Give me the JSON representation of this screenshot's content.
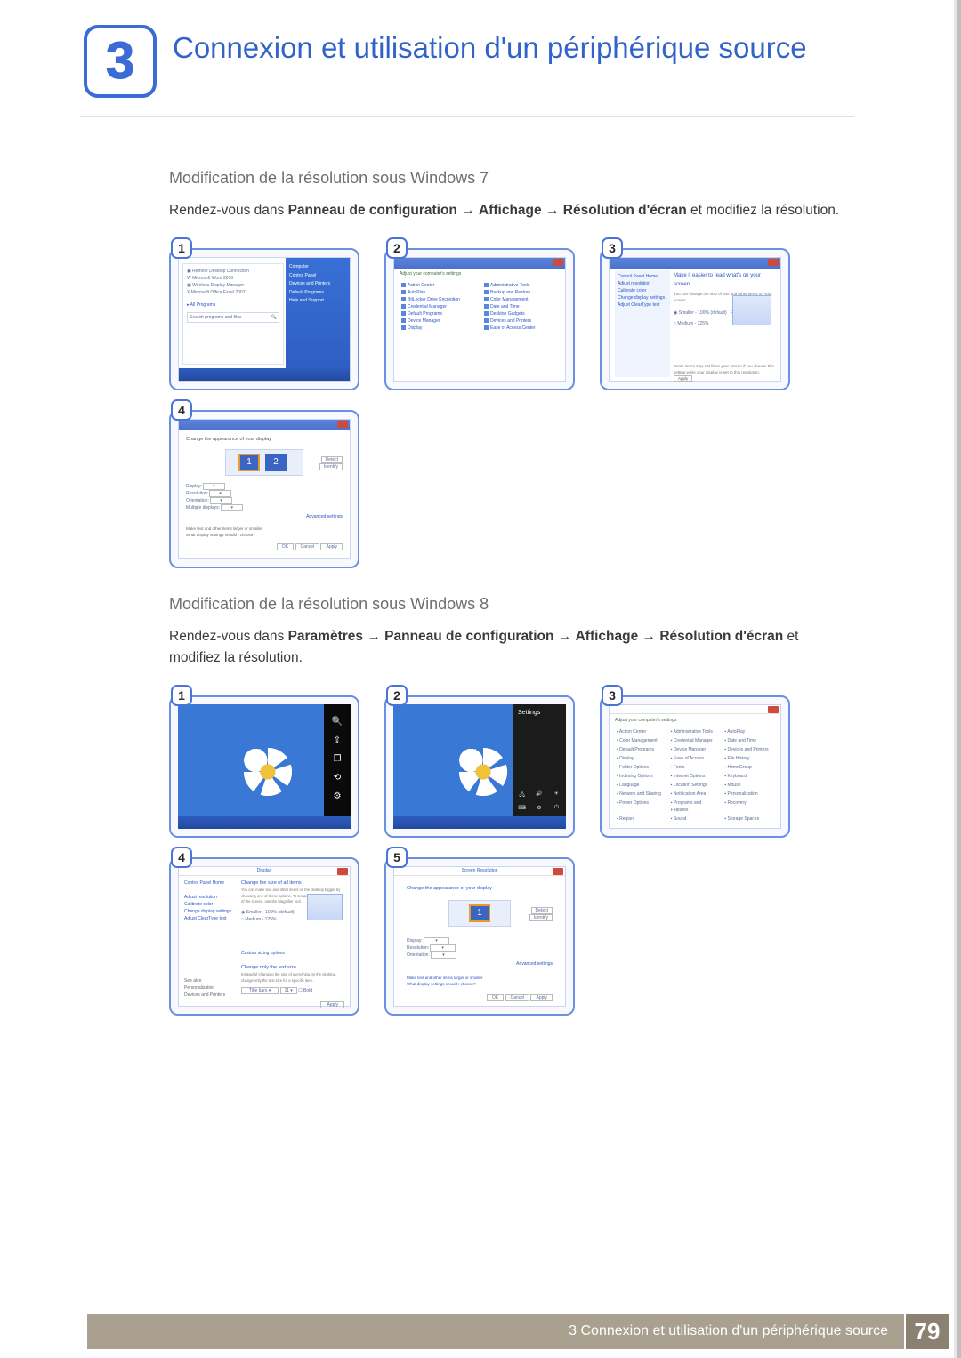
{
  "chapter": {
    "number": "3",
    "title": "Connexion et utilisation d'un périphérique source"
  },
  "win7": {
    "heading": "Modification de la résolution sous Windows 7",
    "instr_pre": "Rendez-vous dans ",
    "path_1": "Panneau de configuration",
    "arrow": " → ",
    "path_2": "Affichage",
    "path_3": "Résolution d'écran",
    "instr_post": " et modifiez la résolution.",
    "steps": {
      "s1": "1",
      "s2": "2",
      "s3": "3",
      "s4": "4"
    }
  },
  "win8": {
    "heading": "Modification de la résolution sous Windows 8",
    "instr_pre": "Rendez-vous dans ",
    "path_0": "Paramètres",
    "arrow": " → ",
    "path_1": "Panneau de configuration",
    "path_2": "Affichage",
    "path_3": "Résolution d'écran",
    "instr_post": " et modifiez la résolution.",
    "steps": {
      "s1": "1",
      "s2": "2",
      "s3": "3",
      "s4": "4",
      "s5": "5"
    }
  },
  "footer": {
    "text": "3 Connexion et utilisation d'un périphérique source",
    "page": "79"
  }
}
